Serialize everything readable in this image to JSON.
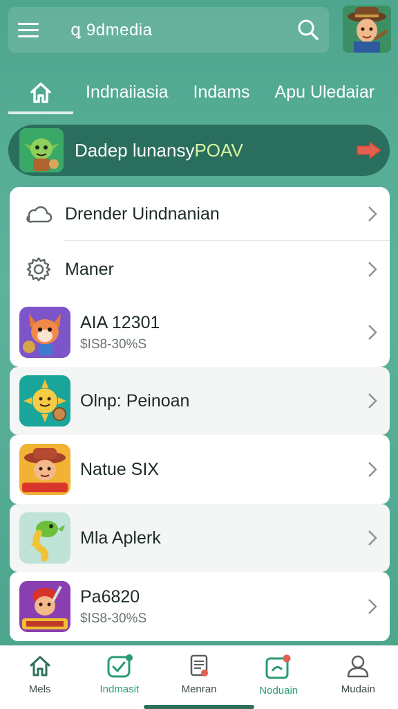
{
  "header": {
    "title": "ꝗ 9dmedia",
    "menu_icon": "hamburger-icon",
    "search_icon": "search-icon"
  },
  "tabs": [
    {
      "label": "Indnaiiasia"
    },
    {
      "label": "Indams"
    },
    {
      "label": "Apu Uledaiar"
    }
  ],
  "banner": {
    "text": "Dadep lunansy",
    "accent": "POAV"
  },
  "list": [
    {
      "label": "Drender Uindnanian",
      "icon": "cloud-icon"
    },
    {
      "label": "Maner",
      "icon": "gear-icon"
    },
    {
      "label": "AIA 12301",
      "sub": "$IS8-30%S"
    },
    {
      "label": "Olnp: Peinoan"
    },
    {
      "label": "Natue SIX"
    },
    {
      "label": "Mla Aplerk"
    },
    {
      "label": "Pa6820",
      "sub": "$IS8-30%S"
    }
  ],
  "bottom_nav": [
    {
      "label": "Mels",
      "icon": "home-icon"
    },
    {
      "label": "Indmasit",
      "icon": "shield-check-icon"
    },
    {
      "label": "Menran",
      "icon": "document-icon"
    },
    {
      "label": "Noduain",
      "icon": "chat-icon"
    },
    {
      "label": "Mudain",
      "icon": "user-icon"
    }
  ],
  "colors": {
    "background": "#4fa68e",
    "banner": "#2a6e5e",
    "accent_green": "#2a9b73",
    "badge": "#e2604f"
  }
}
